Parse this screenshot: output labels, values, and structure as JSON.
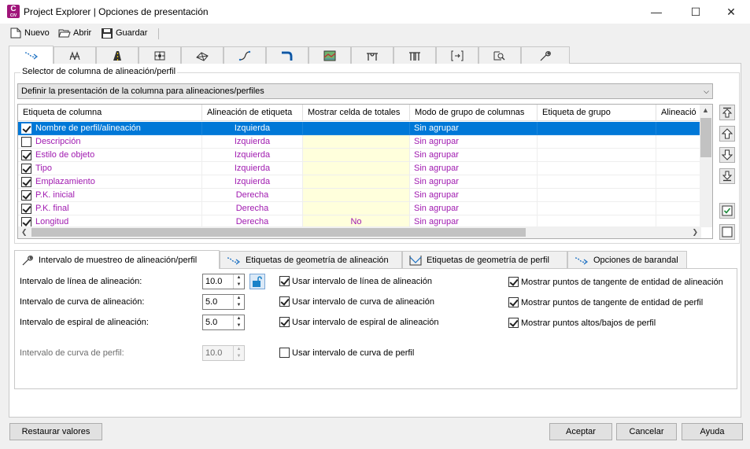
{
  "window": {
    "app_icon_letter": "C",
    "app_icon_sub": "CIV",
    "title": "Project Explorer | Opciones de presentación",
    "minimize_glyph": "—",
    "maximize_glyph": "☐",
    "close_glyph": "✕"
  },
  "toolbar": {
    "new_label": "Nuevo",
    "open_label": "Abrir",
    "save_label": "Guardar",
    "new_icon": "new-document-icon",
    "open_icon": "open-folder-icon",
    "save_icon": "floppy-disk-icon"
  },
  "top_tabs": [
    {
      "icon": "alignment-icon"
    },
    {
      "icon": "sites-icon"
    },
    {
      "icon": "road-corridor-icon"
    },
    {
      "icon": "point-group-icon"
    },
    {
      "icon": "surface-icon"
    },
    {
      "icon": "profile-curve-icon"
    },
    {
      "icon": "pipe-network-icon"
    },
    {
      "icon": "map-icon"
    },
    {
      "icon": "structure-icon"
    },
    {
      "icon": "structure-2-icon"
    },
    {
      "icon": "section-icon"
    },
    {
      "icon": "feature-line-icon"
    },
    {
      "icon": "wrench-icon"
    }
  ],
  "selector": {
    "group_label": "Selector de columna de alineación/perfil",
    "value": "Definir la presentación de la columna para alineaciones/perfiles"
  },
  "grid": {
    "headers": [
      "Etiqueta de columna",
      "Alineación de etiqueta",
      "Mostrar celda de totales",
      "Modo de grupo de columnas",
      "Etiqueta de grupo",
      "Alineació"
    ],
    "rows": [
      {
        "checked": true,
        "name": "Nombre de perfil/alineación",
        "align": "Izquierda",
        "totals": "",
        "mode": "Sin agrupar",
        "selected": true
      },
      {
        "checked": false,
        "name": "Descripción",
        "align": "Izquierda",
        "totals": "",
        "mode": "Sin agrupar",
        "selected": false
      },
      {
        "checked": true,
        "name": "Estilo de objeto",
        "align": "Izquierda",
        "totals": "",
        "mode": "Sin agrupar",
        "selected": false
      },
      {
        "checked": true,
        "name": "Tipo",
        "align": "Izquierda",
        "totals": "",
        "mode": "Sin agrupar",
        "selected": false
      },
      {
        "checked": true,
        "name": "Emplazamiento",
        "align": "Izquierda",
        "totals": "",
        "mode": "Sin agrupar",
        "selected": false
      },
      {
        "checked": true,
        "name": "P.K. inicial",
        "align": "Derecha",
        "totals": "",
        "mode": "Sin agrupar",
        "selected": false
      },
      {
        "checked": true,
        "name": "P.K. final",
        "align": "Derecha",
        "totals": "",
        "mode": "Sin agrupar",
        "selected": false
      },
      {
        "checked": true,
        "name": "Longitud",
        "align": "Derecha",
        "totals": "No",
        "mode": "Sin agrupar",
        "selected": false
      }
    ]
  },
  "side_buttons": [
    {
      "icon": "move-top-icon"
    },
    {
      "icon": "move-up-icon"
    },
    {
      "icon": "move-down-icon"
    },
    {
      "icon": "move-bottom-icon"
    },
    {
      "icon": "check-all-icon"
    },
    {
      "icon": "uncheck-all-icon"
    }
  ],
  "bottom_tabs": [
    {
      "label": "Intervalo de muestreo de alineación/perfil",
      "icon": "wrench-icon",
      "active": true
    },
    {
      "label": "Etiquetas de geometría de alineación",
      "icon": "alignment-icon",
      "active": false
    },
    {
      "label": "Etiquetas de geometría de perfil",
      "icon": "profile-icon",
      "active": false
    },
    {
      "label": "Opciones de barandal",
      "icon": "railing-icon",
      "active": false
    }
  ],
  "sampling": {
    "alignment_line": {
      "label": "Intervalo de línea de alineación:",
      "value": "10.0",
      "use_label": "Usar intervalo de línea de alineación",
      "use_checked": true
    },
    "alignment_curve": {
      "label": "Intervalo de curva de alineación:",
      "value": "5.0",
      "use_label": "Usar intervalo de curva de alineación",
      "use_checked": true
    },
    "alignment_spiral": {
      "label": "Intervalo de espiral de alineación:",
      "value": "5.0",
      "use_label": "Usar intervalo de espiral de alineación",
      "use_checked": true
    },
    "profile_curve": {
      "label": "Intervalo de curva de perfil:",
      "value": "10.0",
      "use_label": "Usar intervalo de curva de perfil",
      "use_checked": false
    },
    "lock_icon": "lock-open-icon",
    "show_tangent_alignment": {
      "label": "Mostrar puntos de tangente de entidad de alineación",
      "checked": true
    },
    "show_tangent_profile": {
      "label": "Mostrar puntos de tangente de entidad de perfil",
      "checked": true
    },
    "show_high_low": {
      "label": "Mostrar puntos altos/bajos de perfil",
      "checked": true
    }
  },
  "footer": {
    "restore_label": "Restaurar valores",
    "accept_label": "Aceptar",
    "cancel_label": "Cancelar",
    "help_label": "Ayuda"
  },
  "colors": {
    "accent": "#0078d7",
    "value_text": "#a01ab0",
    "totals_cell": "#ffffdc",
    "brand": "#a0157a"
  }
}
